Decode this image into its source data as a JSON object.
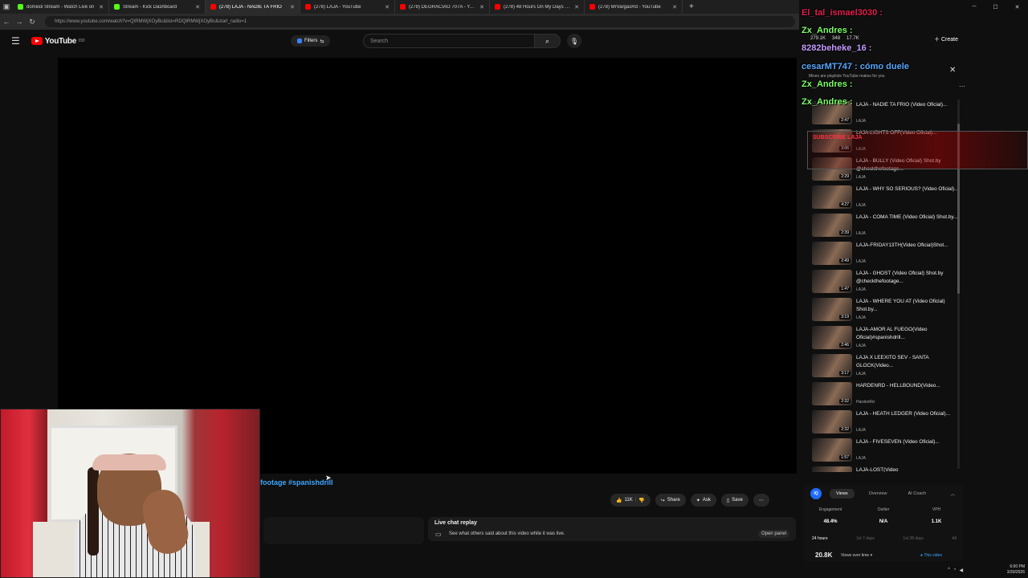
{
  "browser": {
    "tabs": [
      {
        "title": "domiiiol Stream - Watch Live on",
        "color": "#53fc18"
      },
      {
        "title": "Stream - Kick Dashboard",
        "color": "#53fc18"
      },
      {
        "title": "(278) LAJA - NADIE TA FRIO",
        "color": "#ff0000"
      },
      {
        "title": "(278) LAJA - YouTube",
        "color": "#ff0000"
      },
      {
        "title": "(278) DEGRACIAO 707A - YouTube",
        "color": "#ff0000"
      },
      {
        "title": "(278) 48 Hours On My Days Off",
        "color": "#ff0000"
      },
      {
        "title": "(278) MrVargasRd - YouTube",
        "color": "#ff0000"
      }
    ],
    "url": "https://www.youtube.com/watch?v=QtRMWjXOyBc&list=RDQtRMWjXOyBc&start_radio=1"
  },
  "youtube": {
    "logo_text": "YouTube",
    "country": "DO",
    "filters_label": "Filters",
    "search_placeholder": "Search"
  },
  "video": {
    "hashtags": "footage #spanishdrill",
    "like_count": "11K",
    "share_label": "Share",
    "ask_label": "Ask",
    "save_label": "Save",
    "live_chat_replay_title": "Live chat replay",
    "live_chat_replay_sub": "See what others said about this video while it was live.",
    "open_panel_label": "Open panel"
  },
  "chat_overlay": [
    {
      "text": "El_tal_ismael3030 :",
      "color": "#e51f4f"
    },
    {
      "text": "Zx_Andres :",
      "color": "#7dff6a"
    },
    {
      "text": "8282beheke_16 :",
      "color": "#c59bff"
    },
    {
      "text": "cesarMT747 : cómo duele",
      "color": "#56a8ff"
    },
    {
      "text": "Zx_Andres :",
      "color": "#7dff6a"
    },
    {
      "text": "Zx_Andres :",
      "color": "#7dff6a"
    }
  ],
  "header_stats": {
    "a": "279.1K",
    "b": "348",
    "c": "17.7K",
    "create_label": "Create"
  },
  "mix": {
    "subtitle": "Mixes are playlists YouTube makes for you"
  },
  "alert_text": "SUBSCRIBE LAJA",
  "playlist": [
    {
      "title": "LAJA - NADIE TA FRIO (Video Oficial)...",
      "channel": "LAJA",
      "duration": "2:47"
    },
    {
      "title": "LAJA-LIGHTS OFF(Video Oficial)...",
      "channel": "LAJA",
      "duration": "3:06"
    },
    {
      "title": "LAJA - BULLY (Video Oficial) Shot.by @checkthefootage...",
      "channel": "LAJA",
      "duration": "2:29"
    },
    {
      "title": "LAJA - WHY SO SERIOUS? (Video Oficial)...",
      "channel": "LAJA",
      "duration": "4:27"
    },
    {
      "title": "LAJA - COMA TIME (Video Oficial) Shot.by...",
      "channel": "LAJA",
      "duration": "2:39"
    },
    {
      "title": "LAJA-FRIDAY13TH(Video Oficial)Shot...",
      "channel": "LAJA",
      "duration": "2:49"
    },
    {
      "title": "LAJA - GHOST (Video Oficial) Shot.by @checkthefootage...",
      "channel": "LAJA",
      "duration": "1:47"
    },
    {
      "title": "LAJA - WHERE YOU AT (Video Oficial) Shot.by...",
      "channel": "LAJA",
      "duration": "3:19"
    },
    {
      "title": "LAJA-AMOR AL FUEGO(Video Oficial)#spanishdrill...",
      "channel": "LAJA",
      "duration": "2:46"
    },
    {
      "title": "LAJA X LEEXITO SEV - SANTA GLOCK(Video...",
      "channel": "LAJA",
      "duration": "3:17"
    },
    {
      "title": "HARDENRD - HELLBOUND(Video...",
      "channel": "HardenRd",
      "duration": "2:32"
    },
    {
      "title": "LAJA - HEATH LEDGER (Video Oficial)...",
      "channel": "LAJA",
      "duration": "2:32"
    },
    {
      "title": "LAJA - FIVESEVEN (Video Oficial)...",
      "channel": "LAJA",
      "duration": "1:57"
    },
    {
      "title": "LAJA-LOST(Video",
      "channel": "",
      "duration": ""
    }
  ],
  "vidiq": {
    "logo": "IQ",
    "tabs": [
      "Views",
      "Overview",
      "AI Coach"
    ],
    "metrics": [
      {
        "label": "Engagement",
        "value": "48.4%"
      },
      {
        "label": "Outlier",
        "value": "N/A"
      },
      {
        "label": "VPH",
        "value": "1.1K"
      }
    ],
    "ranges": [
      "24 hours",
      "1st 7 days",
      "1st 28 days",
      "All"
    ],
    "views_total": "20.8K",
    "views_over_time": "Views over time",
    "this_video": "This video"
  },
  "taskbar": {
    "time": "6:00 PM",
    "date": "3/30/2026"
  }
}
